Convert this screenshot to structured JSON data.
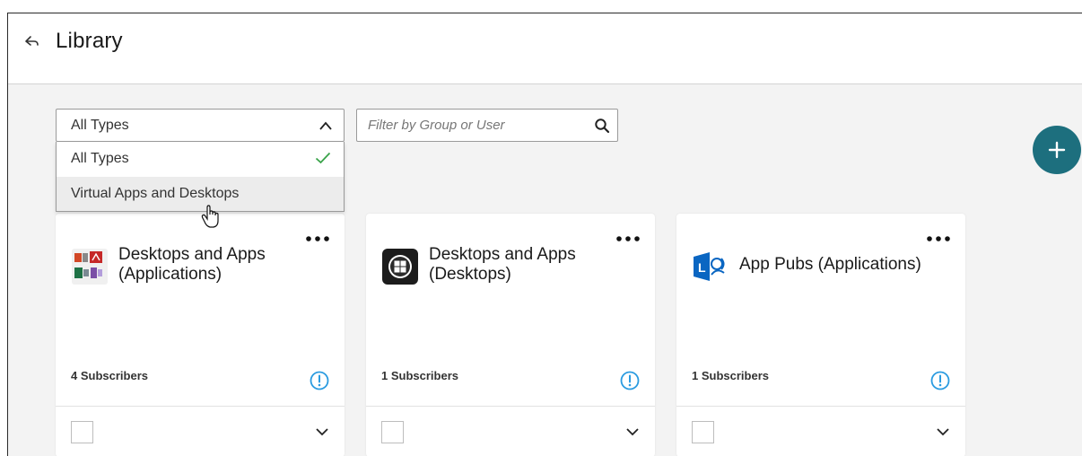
{
  "header": {
    "title": "Library"
  },
  "type_filter": {
    "selected": "All Types",
    "options": [
      {
        "label": "All Types",
        "checked": true
      },
      {
        "label": "Virtual Apps and Desktops",
        "checked": false
      }
    ]
  },
  "search": {
    "placeholder": "Filter by Group or User"
  },
  "colors": {
    "accent": "#1d6f7e",
    "check": "#3aa34a",
    "info": "#2a9be0"
  },
  "cards": [
    {
      "title": "Desktops and Apps (Applications)",
      "subscribers": "4 Subscribers",
      "icon": "office-apps-icon"
    },
    {
      "title": "Desktops and Apps (Desktops)",
      "subscribers": "1 Subscribers",
      "icon": "windows-desktop-icon"
    },
    {
      "title": "App Pubs (Applications)",
      "subscribers": "1 Subscribers",
      "icon": "lync-app-icon"
    }
  ]
}
